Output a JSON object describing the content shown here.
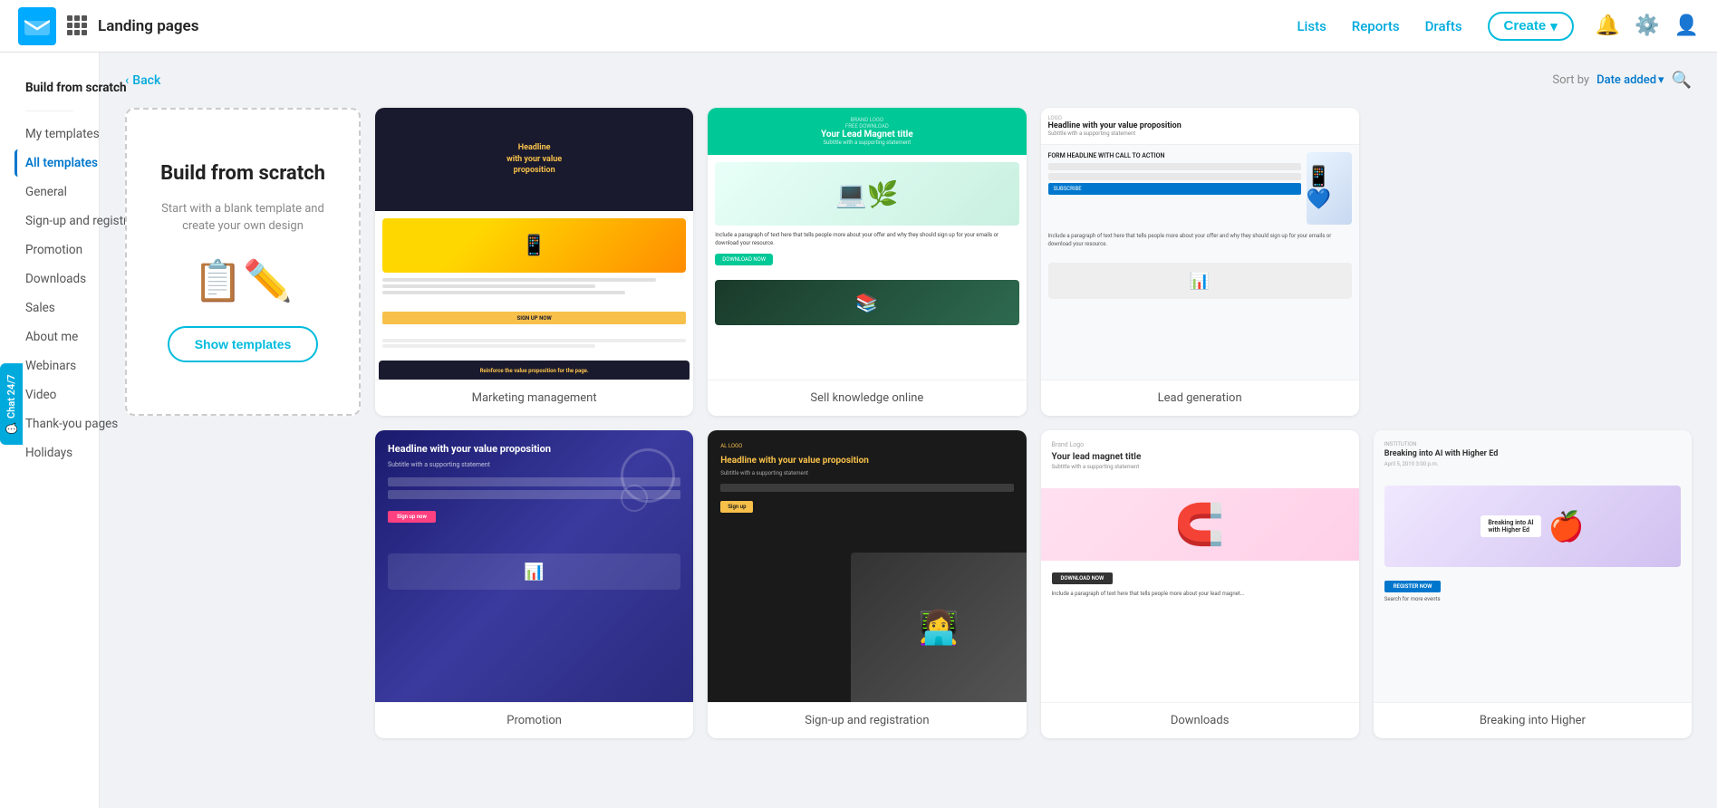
{
  "app": {
    "logo_alt": "Sender logo",
    "name": "Landing pages"
  },
  "topnav": {
    "links": [
      {
        "id": "lists",
        "label": "Lists"
      },
      {
        "id": "reports",
        "label": "Reports"
      },
      {
        "id": "drafts",
        "label": "Drafts"
      }
    ],
    "create_label": "Create",
    "create_chevron": "▾"
  },
  "back_label": "Back",
  "sort": {
    "label": "Sort by",
    "value": "Date added",
    "chevron": "▾"
  },
  "sidebar": {
    "build_from_scratch": "Build from scratch",
    "sections": [
      {
        "id": "my-templates",
        "label": "My templates"
      },
      {
        "id": "all-templates",
        "label": "All templates",
        "active": true
      },
      {
        "id": "general",
        "label": "General"
      },
      {
        "id": "signup",
        "label": "Sign-up and registration"
      },
      {
        "id": "promotion",
        "label": "Promotion"
      },
      {
        "id": "downloads",
        "label": "Downloads"
      },
      {
        "id": "sales",
        "label": "Sales"
      },
      {
        "id": "about-me",
        "label": "About me"
      },
      {
        "id": "webinars",
        "label": "Webinars"
      },
      {
        "id": "video",
        "label": "Video"
      },
      {
        "id": "thank-you",
        "label": "Thank-you pages"
      },
      {
        "id": "holidays",
        "label": "Holidays"
      }
    ]
  },
  "scratch_card": {
    "title": "Build from scratch",
    "description": "Start with a blank template and create your own design",
    "button_label": "Show templates"
  },
  "templates_row1": [
    {
      "id": "marketing-management",
      "label": "Marketing management"
    },
    {
      "id": "sell-knowledge-online",
      "label": "Sell knowledge online"
    },
    {
      "id": "lead-generation",
      "label": "Lead generation"
    }
  ],
  "templates_row2": [
    {
      "id": "promo-dark-blue",
      "label": "Promotion"
    },
    {
      "id": "dark-headline",
      "label": "Sign-up and registration"
    },
    {
      "id": "lead-magnet",
      "label": "Downloads"
    },
    {
      "id": "breaking-higher-ed",
      "label": "Breaking into Higher"
    }
  ],
  "chat_widget": {
    "label": "Chat 24/7"
  }
}
